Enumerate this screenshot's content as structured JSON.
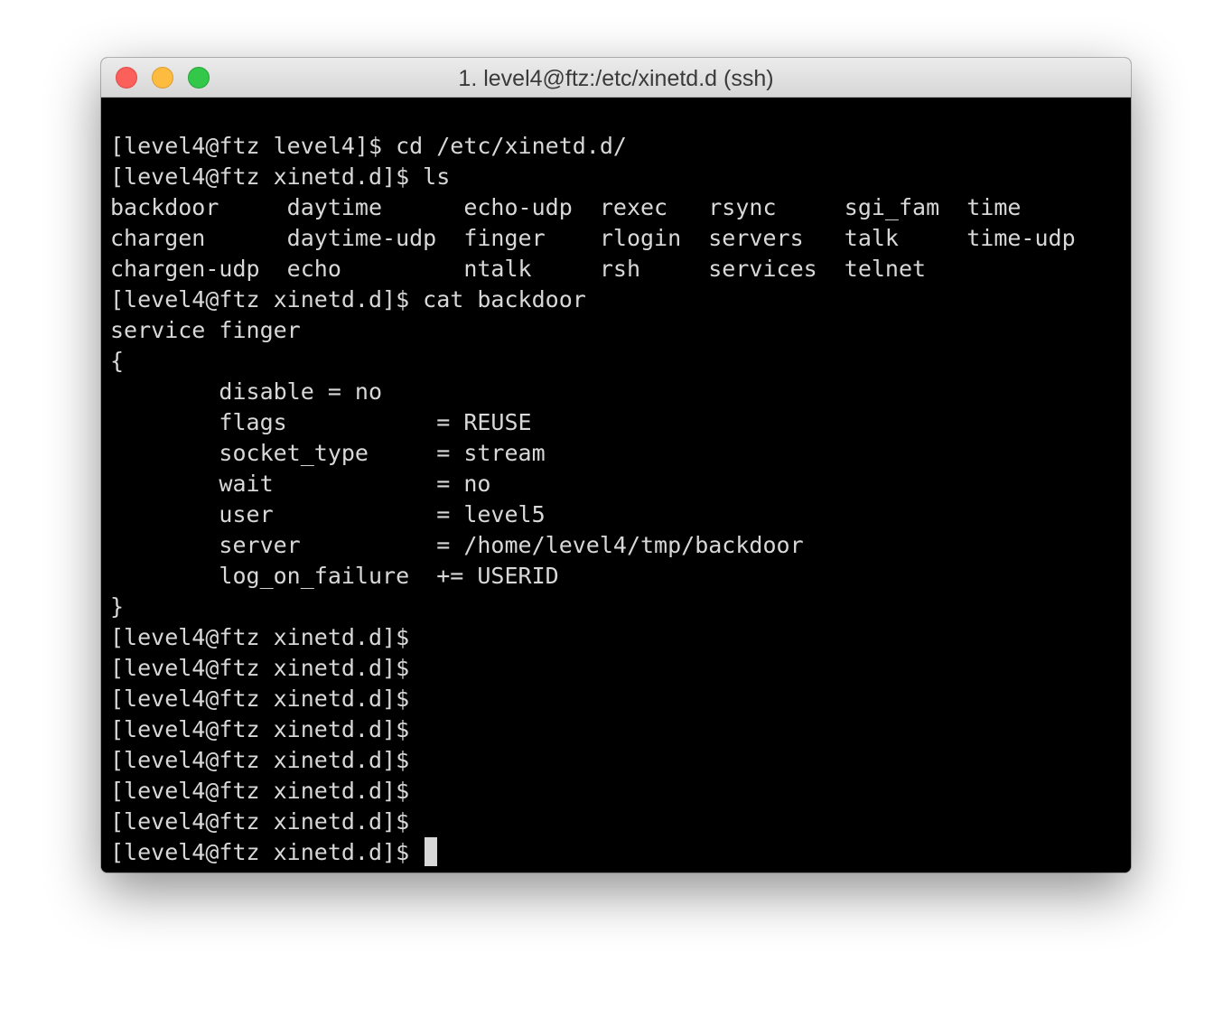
{
  "window": {
    "title": "1. level4@ftz:/etc/xinetd.d (ssh)",
    "traffic_lights": {
      "close_color": "#fc605b",
      "minimize_color": "#fdbc40",
      "zoom_color": "#34c84a"
    }
  },
  "terminal": {
    "background": "#000000",
    "foreground": "#d8d8d8",
    "lines": [
      "[level4@ftz level4]$ cd /etc/xinetd.d/",
      "[level4@ftz xinetd.d]$ ls",
      "backdoor     daytime      echo-udp  rexec   rsync     sgi_fam  time",
      "chargen      daytime-udp  finger    rlogin  servers   talk     time-udp",
      "chargen-udp  echo         ntalk     rsh     services  telnet",
      "[level4@ftz xinetd.d]$ cat backdoor",
      "service finger",
      "{",
      "        disable = no",
      "        flags           = REUSE",
      "        socket_type     = stream",
      "        wait            = no",
      "        user            = level5",
      "        server          = /home/level4/tmp/backdoor",
      "        log_on_failure  += USERID",
      "}",
      "[level4@ftz xinetd.d]$",
      "[level4@ftz xinetd.d]$",
      "[level4@ftz xinetd.d]$",
      "[level4@ftz xinetd.d]$",
      "[level4@ftz xinetd.d]$",
      "[level4@ftz xinetd.d]$",
      "[level4@ftz xinetd.d]$",
      "[level4@ftz xinetd.d]$ "
    ]
  }
}
